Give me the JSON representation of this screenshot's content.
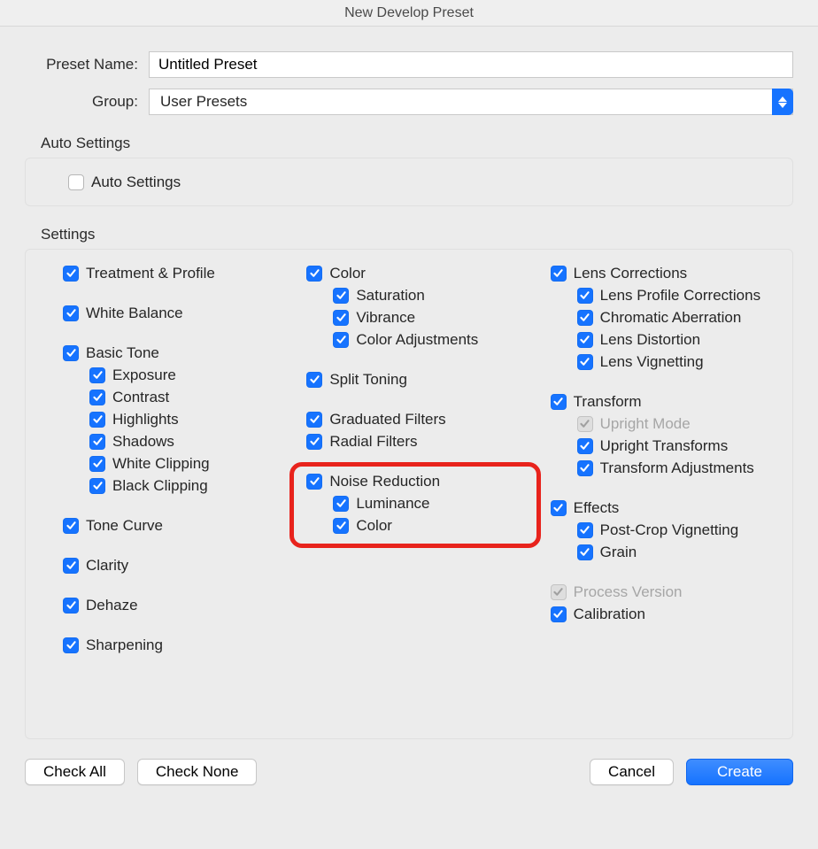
{
  "title": "New Develop Preset",
  "labels": {
    "preset_name": "Preset Name:",
    "group": "Group:"
  },
  "fields": {
    "preset_name_value": "Untitled Preset",
    "group_value": "User Presets"
  },
  "sections": {
    "auto": {
      "title": "Auto Settings",
      "items": {
        "auto_settings": {
          "label": "Auto Settings",
          "checked": false
        }
      }
    },
    "settings": {
      "title": "Settings",
      "columns": {
        "col1": [
          {
            "key": "treatment_profile",
            "label": "Treatment & Profile",
            "checked": true,
            "children": []
          },
          {
            "key": "white_balance",
            "label": "White Balance",
            "checked": true,
            "gapBefore": true,
            "children": []
          },
          {
            "key": "basic_tone",
            "label": "Basic Tone",
            "checked": true,
            "gapBefore": true,
            "children": [
              {
                "key": "exposure",
                "label": "Exposure",
                "checked": true
              },
              {
                "key": "contrast",
                "label": "Contrast",
                "checked": true
              },
              {
                "key": "highlights",
                "label": "Highlights",
                "checked": true
              },
              {
                "key": "shadows",
                "label": "Shadows",
                "checked": true
              },
              {
                "key": "white_clipping",
                "label": "White Clipping",
                "checked": true
              },
              {
                "key": "black_clipping",
                "label": "Black Clipping",
                "checked": true
              }
            ]
          },
          {
            "key": "tone_curve",
            "label": "Tone Curve",
            "checked": true,
            "gapBefore": true,
            "children": []
          },
          {
            "key": "clarity",
            "label": "Clarity",
            "checked": true,
            "gapBefore": true,
            "children": []
          },
          {
            "key": "dehaze",
            "label": "Dehaze",
            "checked": true,
            "gapBefore": true,
            "children": []
          },
          {
            "key": "sharpening",
            "label": "Sharpening",
            "checked": true,
            "gapBefore": true,
            "children": []
          }
        ],
        "col2": [
          {
            "key": "color",
            "label": "Color",
            "checked": true,
            "children": [
              {
                "key": "saturation",
                "label": "Saturation",
                "checked": true
              },
              {
                "key": "vibrance",
                "label": "Vibrance",
                "checked": true
              },
              {
                "key": "color_adjustments",
                "label": "Color Adjustments",
                "checked": true
              }
            ]
          },
          {
            "key": "split_toning",
            "label": "Split Toning",
            "checked": true,
            "gapBefore": true,
            "children": []
          },
          {
            "key": "graduated_filters",
            "label": "Graduated Filters",
            "checked": true,
            "gapBefore": true,
            "children": []
          },
          {
            "key": "radial_filters",
            "label": "Radial Filters",
            "checked": true,
            "children": []
          },
          {
            "key": "noise_reduction",
            "label": "Noise Reduction",
            "checked": true,
            "gapBefore": true,
            "children": [
              {
                "key": "nr_luminance",
                "label": "Luminance",
                "checked": true
              },
              {
                "key": "nr_color",
                "label": "Color",
                "checked": true
              }
            ]
          }
        ],
        "col3": [
          {
            "key": "lens_corrections",
            "label": "Lens Corrections",
            "checked": true,
            "children": [
              {
                "key": "lens_profile_corrections",
                "label": "Lens Profile Corrections",
                "checked": true
              },
              {
                "key": "chromatic_aberration",
                "label": "Chromatic Aberration",
                "checked": true
              },
              {
                "key": "lens_distortion",
                "label": "Lens Distortion",
                "checked": true
              },
              {
                "key": "lens_vignetting",
                "label": "Lens Vignetting",
                "checked": true
              }
            ]
          },
          {
            "key": "transform",
            "label": "Transform",
            "checked": true,
            "gapBefore": true,
            "children": [
              {
                "key": "upright_mode",
                "label": "Upright Mode",
                "checked": true,
                "disabled": true
              },
              {
                "key": "upright_transforms",
                "label": "Upright Transforms",
                "checked": true
              },
              {
                "key": "transform_adjustments",
                "label": "Transform Adjustments",
                "checked": true
              }
            ]
          },
          {
            "key": "effects",
            "label": "Effects",
            "checked": true,
            "gapBefore": true,
            "children": [
              {
                "key": "post_crop_vignetting",
                "label": "Post-Crop Vignetting",
                "checked": true
              },
              {
                "key": "grain",
                "label": "Grain",
                "checked": true
              }
            ]
          },
          {
            "key": "process_version",
            "label": "Process Version",
            "checked": true,
            "disabled": true,
            "gapBefore": true,
            "children": []
          },
          {
            "key": "calibration",
            "label": "Calibration",
            "checked": true,
            "children": []
          }
        ]
      }
    }
  },
  "buttons": {
    "check_all": "Check All",
    "check_none": "Check None",
    "cancel": "Cancel",
    "create": "Create"
  },
  "annotation": {
    "highlight": "noise-reduction-group"
  },
  "colors": {
    "accent": "#1673ff",
    "highlight_border": "#e8231c"
  }
}
